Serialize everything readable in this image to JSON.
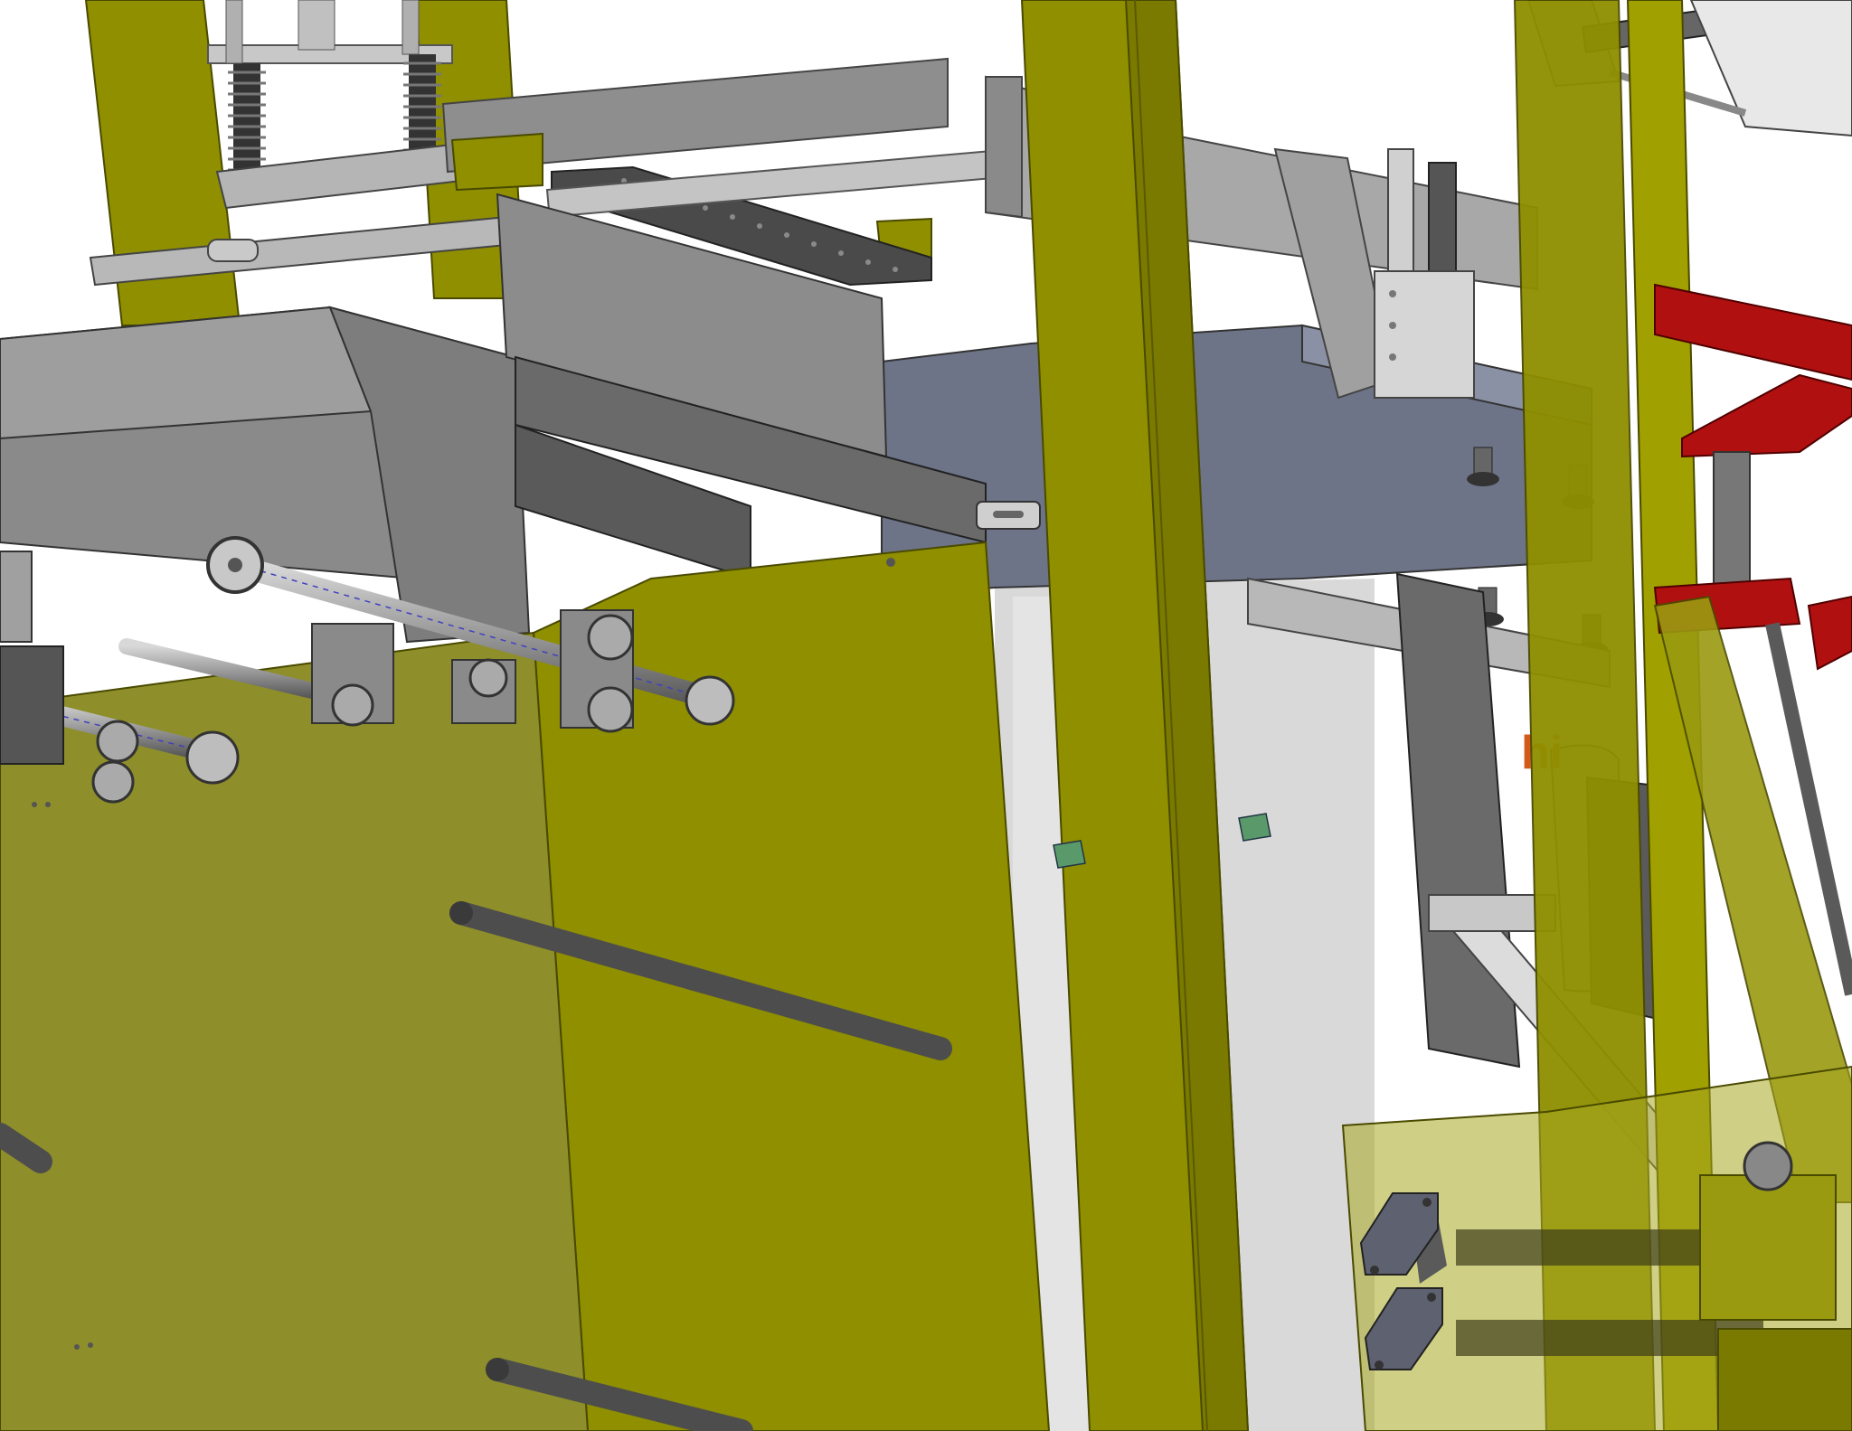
{
  "view": {
    "background": "#ffffff",
    "partial_text": "hi"
  },
  "colors": {
    "frame_yellow": "#8f8f00",
    "frame_yellow_dark": "#6f6f00",
    "frame_yellow_light": "#a8a820",
    "panel_transparent": "#9a9a1a",
    "steel_gray": "#8a8a8a",
    "steel_light": "#b8b8b8",
    "steel_dark": "#555555",
    "blue_gray": "#6e7488",
    "red_arm": "#b01010",
    "orange_label": "#d45a1a"
  }
}
